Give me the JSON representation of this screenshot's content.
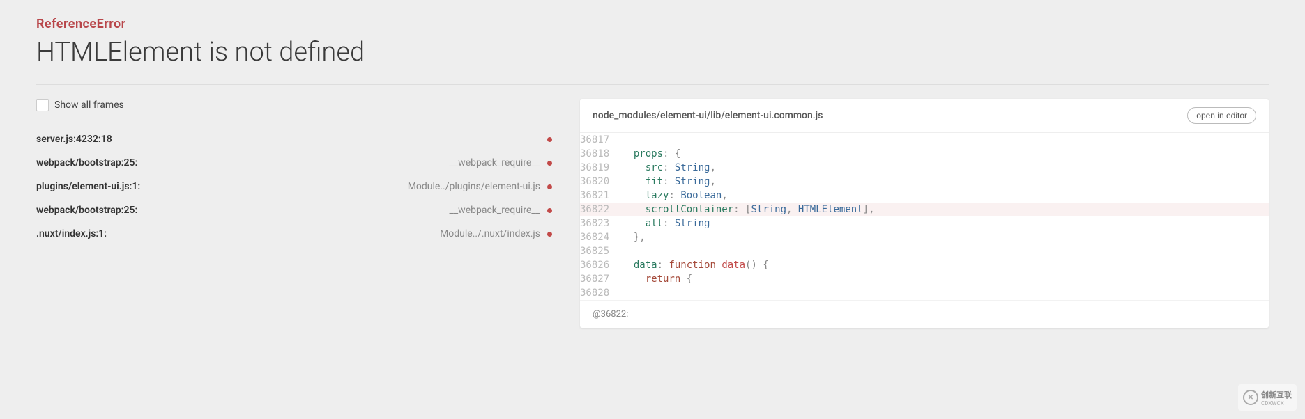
{
  "error": {
    "type": "ReferenceError",
    "message": "HTMLElement is not defined"
  },
  "show_frames_label": "Show all frames",
  "frames": [
    {
      "left": "server.js:4232:18",
      "right": ""
    },
    {
      "left": "webpack/bootstrap:25:",
      "right": "__webpack_require__"
    },
    {
      "left": "plugins/element-ui.js:1:",
      "right": "Module../plugins/element-ui.js"
    },
    {
      "left": "webpack/bootstrap:25:",
      "right": "__webpack_require__"
    },
    {
      "left": ".nuxt/index.js:1:",
      "right": "Module../.nuxt/index.js"
    }
  ],
  "source": {
    "path": "node_modules/element-ui/lib/element-ui.common.js",
    "open_button": "open in editor",
    "highlighted_line": 36822,
    "footer": "@36822:",
    "lines": [
      {
        "n": 36817,
        "html": ""
      },
      {
        "n": 36818,
        "html": "  <span class='tok-key'>props</span><span class='tok-punc'>:</span> <span class='tok-punc'>{</span>"
      },
      {
        "n": 36819,
        "html": "    <span class='tok-key'>src</span><span class='tok-punc'>:</span> <span class='tok-type'>String</span><span class='tok-punc'>,</span>"
      },
      {
        "n": 36820,
        "html": "    <span class='tok-key'>fit</span><span class='tok-punc'>:</span> <span class='tok-type'>String</span><span class='tok-punc'>,</span>"
      },
      {
        "n": 36821,
        "html": "    <span class='tok-key'>lazy</span><span class='tok-punc'>:</span> <span class='tok-type'>Boolean</span><span class='tok-punc'>,</span>"
      },
      {
        "n": 36822,
        "html": "    <span class='tok-key'>scrollContainer</span><span class='tok-punc'>:</span> <span class='tok-punc'>[</span><span class='tok-type'>String</span><span class='tok-punc'>,</span> <span class='tok-type'>HTMLElement</span><span class='tok-punc'>],</span>"
      },
      {
        "n": 36823,
        "html": "    <span class='tok-key'>alt</span><span class='tok-punc'>:</span> <span class='tok-type'>String</span>"
      },
      {
        "n": 36824,
        "html": "  <span class='tok-punc'>},</span>"
      },
      {
        "n": 36825,
        "html": ""
      },
      {
        "n": 36826,
        "html": "  <span class='tok-key'>data</span><span class='tok-punc'>:</span> <span class='tok-kw'>function</span> <span class='tok-fn'>data</span><span class='tok-punc'>()</span> <span class='tok-punc'>{</span>"
      },
      {
        "n": 36827,
        "html": "    <span class='tok-kw'>return</span> <span class='tok-punc'>{</span>"
      },
      {
        "n": 36828,
        "html": ""
      }
    ]
  },
  "watermark": {
    "text": "创新互联",
    "sub": "CDXWCX"
  }
}
